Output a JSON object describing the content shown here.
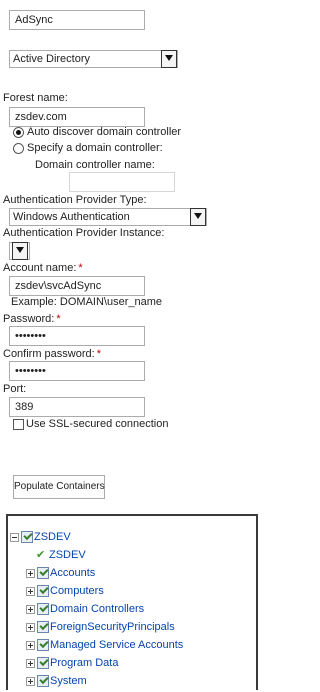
{
  "connection_name": "AdSync",
  "directory_service": {
    "selected": "Active Directory"
  },
  "forest": {
    "label": "Forest name:",
    "value": "zsdev.com"
  },
  "dc_mode": {
    "auto_label": "Auto discover domain controller",
    "specify_label": "Specify a domain controller:",
    "dc_name_label": "Domain controller name:",
    "dc_name_value": ""
  },
  "auth": {
    "type_label": "Authentication Provider Type:",
    "type_value": "Windows Authentication",
    "instance_label": "Authentication Provider Instance:",
    "instance_value": ""
  },
  "account": {
    "label": "Account name:",
    "required_mark": "*",
    "value": "zsdev\\svcAdSync",
    "example": "Example: DOMAIN\\user_name"
  },
  "password": {
    "label": "Password:",
    "required_mark": "*",
    "value": "••••••••"
  },
  "confirm_password": {
    "label": "Confirm password:",
    "required_mark": "*",
    "value": "••••••••"
  },
  "port": {
    "label": "Port:",
    "value": "389"
  },
  "ssl": {
    "label": "Use SSL-secured connection",
    "checked": false
  },
  "populate_button": "Populate Containers",
  "tree": {
    "root": "ZSDEV",
    "root_check": "ZSDEV",
    "items": [
      "Accounts",
      "Computers",
      "Domain Controllers",
      "ForeignSecurityPrincipals",
      "Managed Service Accounts",
      "Program Data",
      "System"
    ]
  },
  "colors": {
    "link": "#0645ad",
    "required": "#c00000",
    "check": "#3a9a2c"
  }
}
